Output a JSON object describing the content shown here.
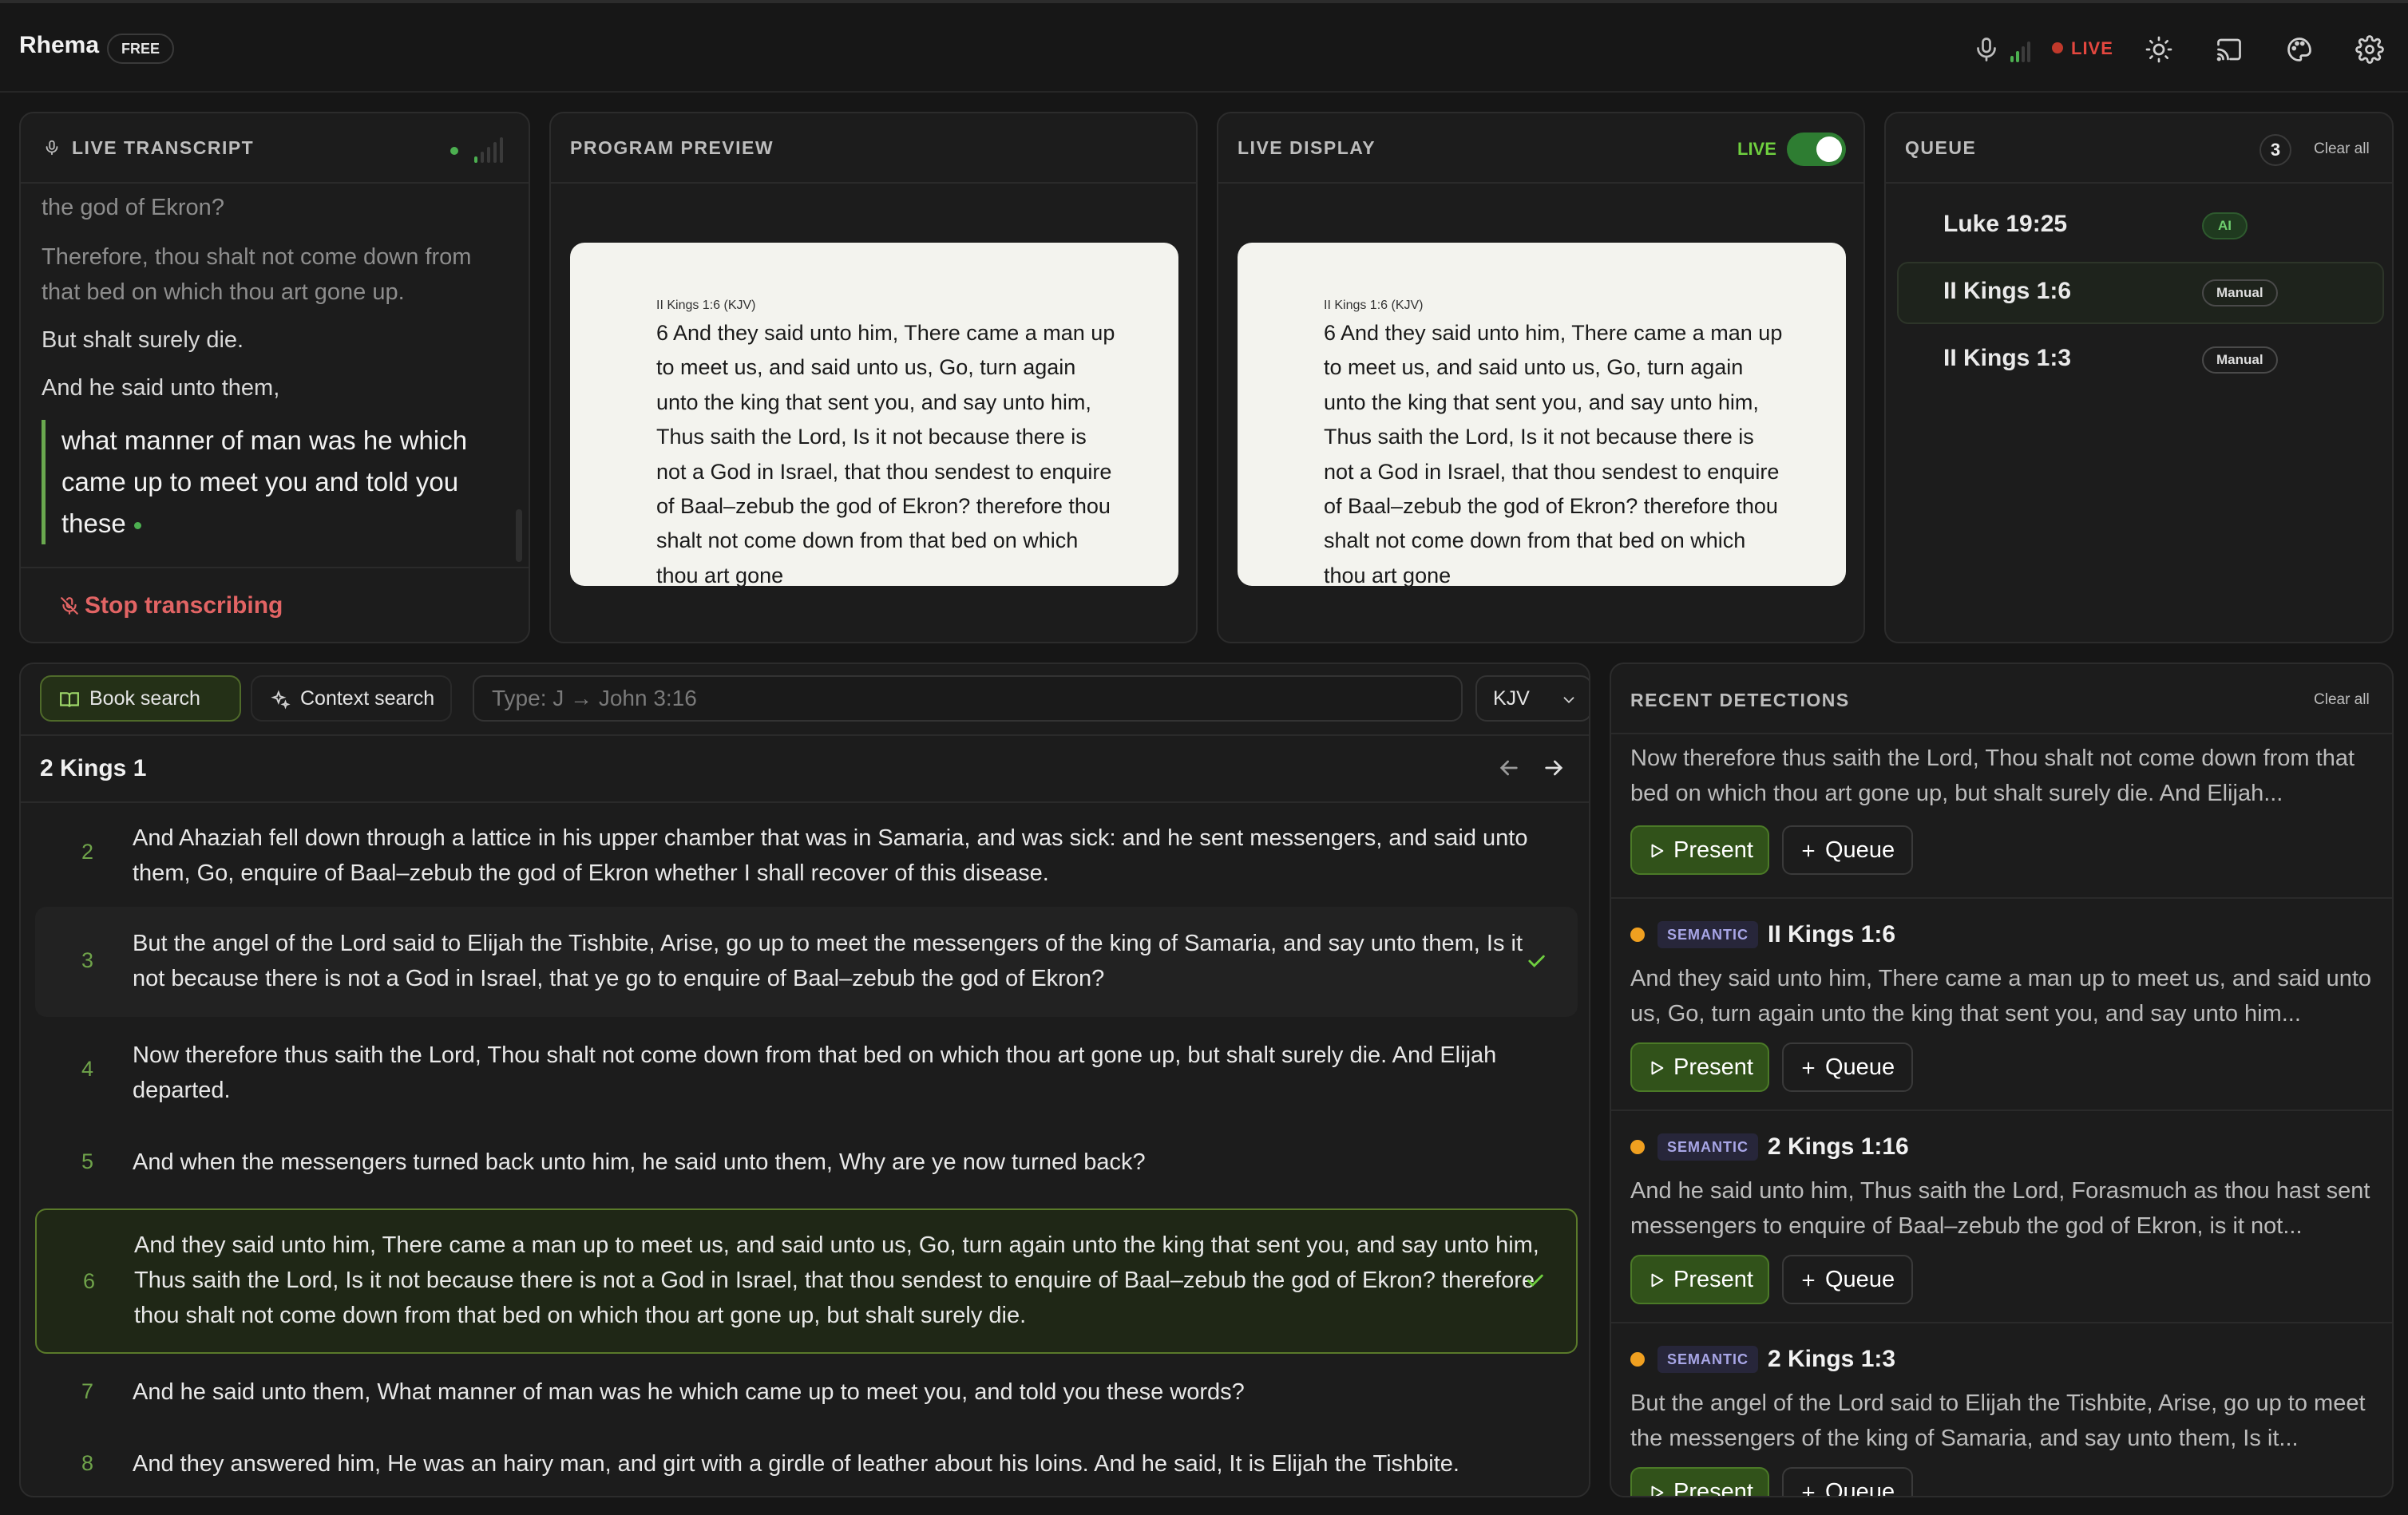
{
  "app": {
    "title": "Rhema",
    "plan_badge": "FREE"
  },
  "topbar": {
    "live_label": "LIVE",
    "icons": [
      "microphone-icon",
      "signal-meter-icon",
      "sun-icon",
      "cast-icon",
      "palette-icon",
      "gear-icon"
    ]
  },
  "colors": {
    "accent_green": "#4b7a27",
    "live_red": "#e4473f",
    "semantic_badge": "#a8a6e6"
  },
  "transcript": {
    "title": "LIVE TRANSCRIPT",
    "lines": [
      "the god of Ekron?",
      "Therefore, thou shalt not come down from",
      "that bed on which thou art gone up.",
      "But shalt surely die.",
      "And he said unto them,"
    ],
    "current": "what manner of man was he which came up to meet you and told you these",
    "stop_label": "Stop transcribing"
  },
  "program_preview": {
    "title": "PROGRAM PREVIEW",
    "reference": "II Kings 1:6 (KJV)",
    "text": "6 And they said unto him, There came a man up to meet us, and said unto us, Go, turn again unto the king that sent you, and say unto him, Thus saith the Lord, Is it not because there is not a God in Israel, that thou sendest to enquire of Baal–zebub the god of Ekron? therefore thou shalt not come down from that bed on which thou art gone"
  },
  "live_display": {
    "title": "LIVE DISPLAY",
    "live_label": "LIVE",
    "live_on": true,
    "reference": "II Kings 1:6 (KJV)",
    "text": "6 And they said unto him, There came a man up to meet us, and said unto us, Go, turn again unto the king that sent you, and say unto him, Thus saith the Lord, Is it not because there is not a God in Israel, that thou sendest to enquire of Baal–zebub the god of Ekron? therefore thou shalt not come down from that bed on which thou art gone"
  },
  "queue": {
    "title": "QUEUE",
    "count": "3",
    "clear_label": "Clear all",
    "items": [
      {
        "ref": "Luke 19:25",
        "tag": "AI"
      },
      {
        "ref": "II Kings 1:6",
        "tag": "Manual"
      },
      {
        "ref": "II Kings 1:3",
        "tag": "Manual"
      }
    ]
  },
  "search": {
    "book_search_label": "Book search",
    "context_search_label": "Context search",
    "placeholder": "Type: J → John 3:16",
    "version": "KJV",
    "chapter_title": "2 Kings 1",
    "verses": [
      {
        "num": "2",
        "text": "And Ahaziah fell down through a lattice in his upper chamber that was in Samaria, and was sick: and he sent messengers, and said unto them, Go, enquire of Baal–zebub the god of Ekron whether I shall recover of this disease."
      },
      {
        "num": "3",
        "text": "But the angel of the Lord said to Elijah the Tishbite, Arise, go up to meet the messengers of the king of Samaria, and say unto them, Is it not because there is not a God in Israel, that ye go to enquire of Baal–zebub the god of Ekron?"
      },
      {
        "num": "4",
        "text": "Now therefore thus saith the Lord, Thou shalt not come down from that bed on which thou art gone up, but shalt surely die. And Elijah departed."
      },
      {
        "num": "5",
        "text": "And when the messengers turned back unto him, he said unto them, Why are ye now turned back?"
      },
      {
        "num": "6",
        "text": "And they said unto him, There came a man up to meet us, and said unto us, Go, turn again unto the king that sent you, and say unto him, Thus saith the Lord, Is it not because there is not a God in Israel, that thou sendest to enquire of Baal–zebub the god of Ekron? therefore thou shalt not come down from that bed on which thou art gone up, but shalt surely die."
      },
      {
        "num": "7",
        "text": "And he said unto them, What manner of man was he which came up to meet you, and told you these words?"
      },
      {
        "num": "8",
        "text": "And they answered him, He was an hairy man, and girt with a girdle of leather about his loins. And he said, It is Elijah the Tishbite."
      }
    ]
  },
  "detections": {
    "title": "RECENT DETECTIONS",
    "clear_label": "Clear all",
    "present_label": "Present",
    "queue_label": "Queue",
    "items": [
      {
        "tag": "",
        "ref": "",
        "text": "Now therefore thus saith the Lord, Thou shalt not come down from that bed on which thou art gone up, but shalt surely die. And Elijah..."
      },
      {
        "tag": "SEMANTIC",
        "ref": "II Kings 1:6",
        "text": "And they said unto him, There came a man up to meet us, and said unto us, Go, turn again unto the king that sent you, and say unto him..."
      },
      {
        "tag": "SEMANTIC",
        "ref": "2 Kings 1:16",
        "text": "And he said unto him, Thus saith the Lord, Forasmuch as thou hast sent messengers to enquire of Baal–zebub the god of Ekron, is it not..."
      },
      {
        "tag": "SEMANTIC",
        "ref": "2 Kings 1:3",
        "text": "But the angel of the Lord said to Elijah the Tishbite, Arise, go up to meet the messengers of the king of Samaria, and say unto them, Is it..."
      }
    ]
  }
}
